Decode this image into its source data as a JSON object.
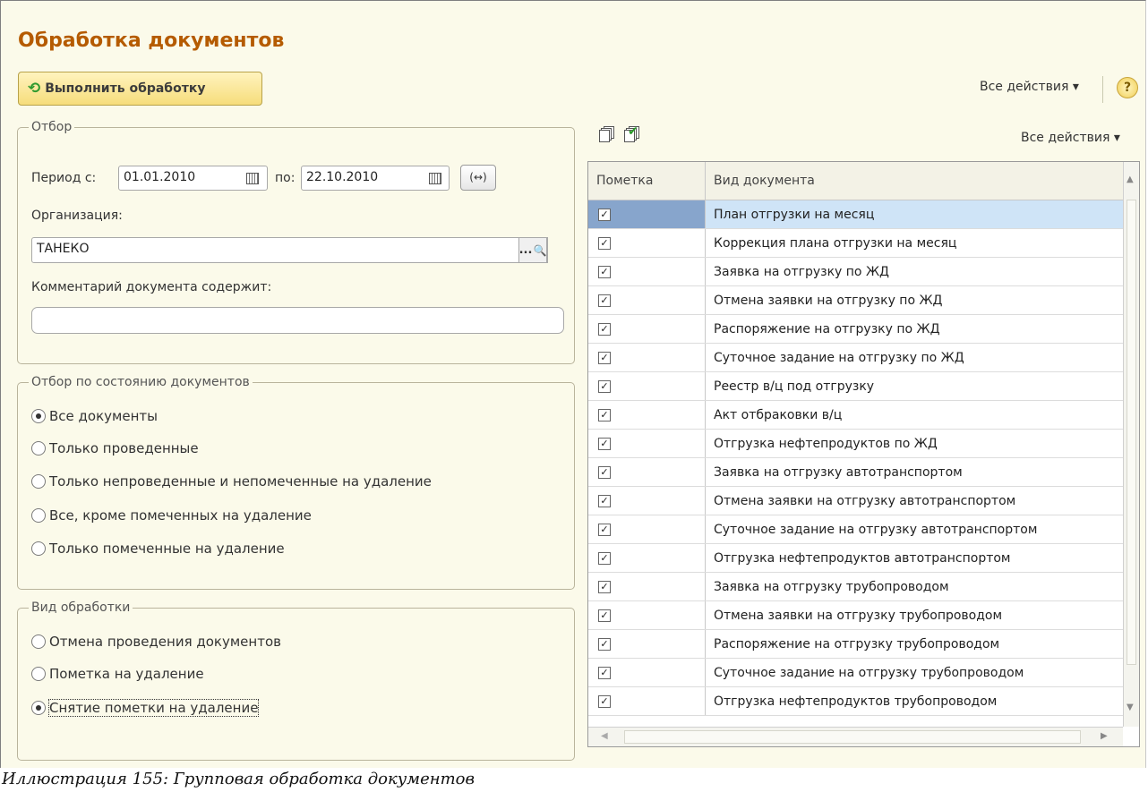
{
  "form": {
    "title": "Обработка документов",
    "run_button": "Выполнить обработку",
    "all_actions": "Все действия ▾",
    "help": "?"
  },
  "filter": {
    "legend": "Отбор",
    "period_from_label": "Период с:",
    "period_from": "01.01.2010",
    "period_to_label": "по:",
    "period_to": "22.10.2010",
    "swap_label": "(↔)",
    "org_label": "Организация:",
    "org_value": "ТАНЕКО",
    "org_select": "...",
    "comment_label": "Комментарий документа содержит:",
    "comment_value": ""
  },
  "state_filter": {
    "legend": "Отбор по состоянию документов",
    "options": [
      "Все документы",
      "Только проведенные",
      "Только непроведенные и непомеченные на удаление",
      "Все, кроме помеченных на удаление",
      "Только помеченные на удаление"
    ],
    "selected_index": 0
  },
  "processing": {
    "legend": "Вид обработки",
    "options": [
      "Отмена проведения документов",
      "Пометка на удаление",
      "Снятие пометки на удаление"
    ],
    "selected_index": 2
  },
  "grid": {
    "all_actions": "Все действия ▾",
    "col_mark": "Пометка",
    "col_type": "Вид документа",
    "rows": [
      {
        "checked": true,
        "name": "План отгрузки на месяц"
      },
      {
        "checked": true,
        "name": "Коррекция плана отгрузки на месяц"
      },
      {
        "checked": true,
        "name": "Заявка на отгрузку по ЖД"
      },
      {
        "checked": true,
        "name": "Отмена заявки на отгрузку по ЖД"
      },
      {
        "checked": true,
        "name": "Распоряжение на отгрузку по ЖД"
      },
      {
        "checked": true,
        "name": "Суточное задание на отгрузку по ЖД"
      },
      {
        "checked": true,
        "name": "Реестр в/ц под отгрузку"
      },
      {
        "checked": true,
        "name": "Акт отбраковки в/ц"
      },
      {
        "checked": true,
        "name": "Отгрузка нефтепродуктов по ЖД"
      },
      {
        "checked": true,
        "name": "Заявка на отгрузку автотранспортом"
      },
      {
        "checked": true,
        "name": "Отмена заявки на отгрузку автотранспортом"
      },
      {
        "checked": true,
        "name": "Суточное задание на отгрузку автотранспортом"
      },
      {
        "checked": true,
        "name": "Отгрузка нефтепродуктов автотранспортом"
      },
      {
        "checked": true,
        "name": "Заявка на отгрузку трубопроводом"
      },
      {
        "checked": true,
        "name": "Отмена заявки на отгрузку трубопроводом"
      },
      {
        "checked": true,
        "name": "Распоряжение на отгрузку трубопроводом"
      },
      {
        "checked": true,
        "name": "Суточное задание на отгрузку трубопроводом"
      },
      {
        "checked": true,
        "name": "Отгрузка нефтепродуктов трубопроводом"
      }
    ]
  },
  "caption": "Иллюстрация 155: Групповая обработка документов"
}
